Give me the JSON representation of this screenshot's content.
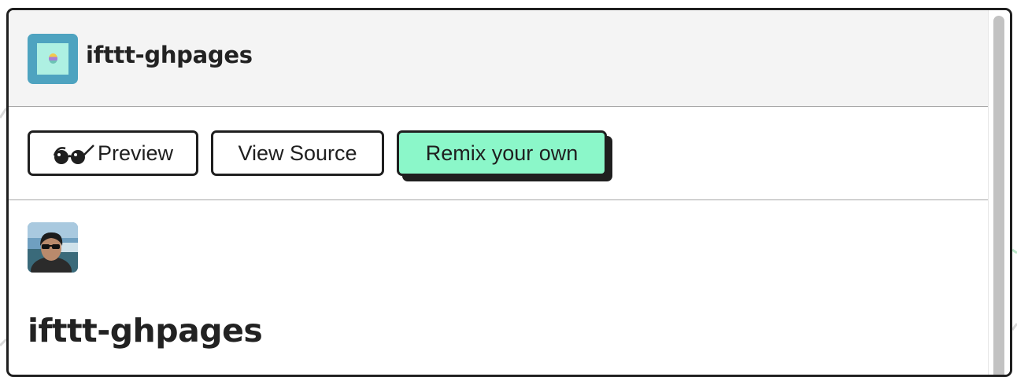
{
  "header": {
    "project_name": "ifttt-ghpages"
  },
  "actions": {
    "preview_label": "Preview",
    "view_source_label": "View Source",
    "remix_label": "Remix your own"
  },
  "content": {
    "title": "ifttt-ghpages"
  },
  "colors": {
    "remix_accent": "#8bf7c9",
    "project_avatar_frame": "#4ea3c0",
    "project_avatar_inner": "#aef0e2",
    "header_background": "#f4f4f4",
    "border": "#1f1f1f"
  },
  "icons": {
    "preview": "sunglasses-icon",
    "project": "project-avatar",
    "user": "user-avatar"
  }
}
